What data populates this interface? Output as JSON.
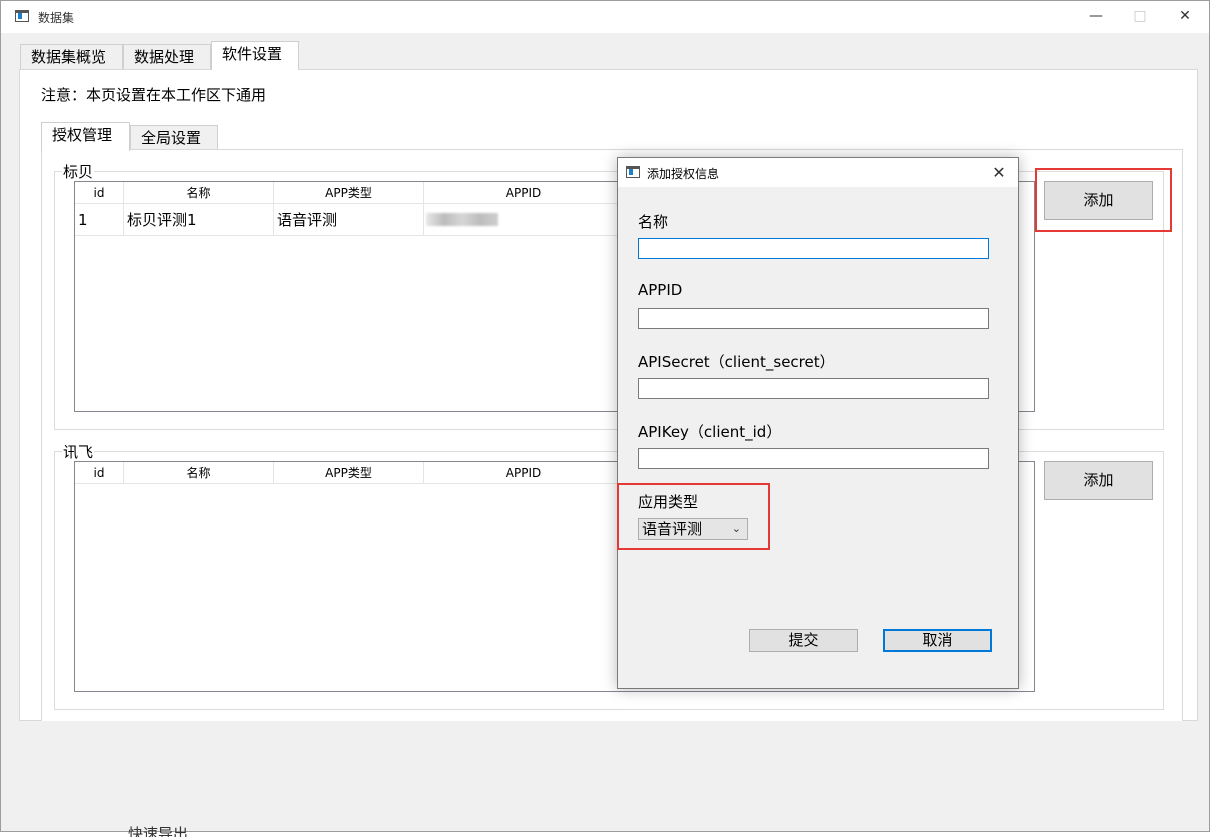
{
  "window": {
    "title": "数据集"
  },
  "main_tabs": [
    {
      "label": "数据集概览"
    },
    {
      "label": "数据处理"
    },
    {
      "label": "软件设置"
    }
  ],
  "note": "注意：本页设置在本工作区下通用",
  "sub_tabs": [
    {
      "label": "授权管理"
    },
    {
      "label": "全局设置"
    }
  ],
  "biaobei": {
    "title": "标贝",
    "columns": [
      "id",
      "名称",
      "APP类型",
      "APPID"
    ],
    "rows": [
      {
        "id": "1",
        "name": "标贝评测1",
        "app_type": "语音评测"
      }
    ],
    "add_label": "添加"
  },
  "xunfei": {
    "title": "讯飞",
    "columns": [
      "id",
      "名称",
      "APP类型",
      "APPID"
    ],
    "add_label": "添加"
  },
  "dialog": {
    "title": "添加授权信息",
    "name_label": "名称",
    "appid_label": "APPID",
    "apisecret_label": "APISecret（client_secret）",
    "apikey_label": "APIKey（client_id）",
    "app_type_label": "应用类型",
    "app_type_value": "语音评测",
    "submit_label": "提交",
    "cancel_label": "取消"
  },
  "bottom_fragment": "快速导出",
  "colors": {
    "highlight": "#e53935",
    "focus": "#0078d7"
  }
}
